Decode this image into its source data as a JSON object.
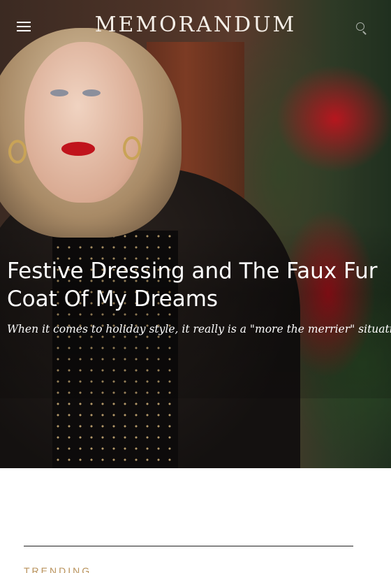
{
  "header": {
    "logo": "MEMORANDUM",
    "menu_icon": "hamburger-menu-icon",
    "search_icon": "search-icon"
  },
  "hero": {
    "title": "Festive Dressing and The Faux Fur Coat Of My Dreams",
    "subtitle": "When it comes to holiday style, it really is a \"more the merrier\" situation."
  },
  "section": {
    "label": "TRENDING"
  },
  "colors": {
    "accent": "#b8915a",
    "hero_text": "#ffffff"
  }
}
